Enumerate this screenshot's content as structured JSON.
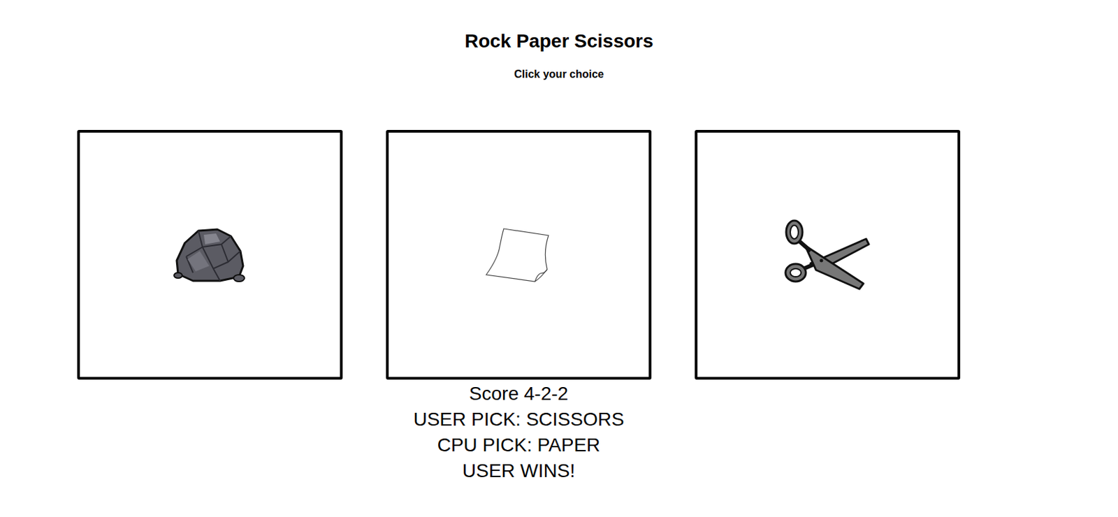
{
  "title": "Rock Paper Scissors",
  "subtitle": "Click your choice",
  "choices": [
    {
      "kind": "rock"
    },
    {
      "kind": "paper"
    },
    {
      "kind": "scissors"
    }
  ],
  "results": {
    "score": "Score 4-2-2",
    "user_pick": "USER PICK: SCISSORS",
    "cpu_pick": "CPU PICK: PAPER",
    "outcome": "USER WINS!"
  }
}
